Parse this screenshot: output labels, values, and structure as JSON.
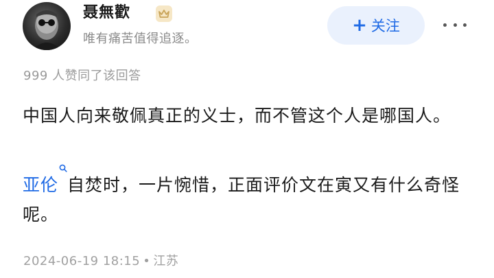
{
  "author": {
    "name": "聂無歡",
    "bio": "唯有痛苦值得追逐。",
    "avatar_icon": "avatar-icon",
    "badge_icon": "crown-icon",
    "badge_color": "#c9a45a"
  },
  "actions": {
    "follow_plus": "+",
    "follow_label": "关注",
    "more_icon": "more-icon"
  },
  "stats": {
    "likes_text": "999 人赞同了该回答"
  },
  "content": {
    "paragraph1": "中国人向来敬佩真正的义士，而不管这个人是哪国人。",
    "link_text": "亚伦",
    "link_icon": "search-icon",
    "paragraph2_rest": "自焚时，一片惋惜，正面评价文在寅又有什么奇怪呢。"
  },
  "meta": {
    "date": "2024-06-19 18:15",
    "separator": "•",
    "location": "江苏"
  },
  "colors": {
    "accent": "#1f6ae5",
    "follow_bg": "#eaf1fd",
    "text": "#1a1a1a",
    "muted": "#9a9a9a"
  }
}
